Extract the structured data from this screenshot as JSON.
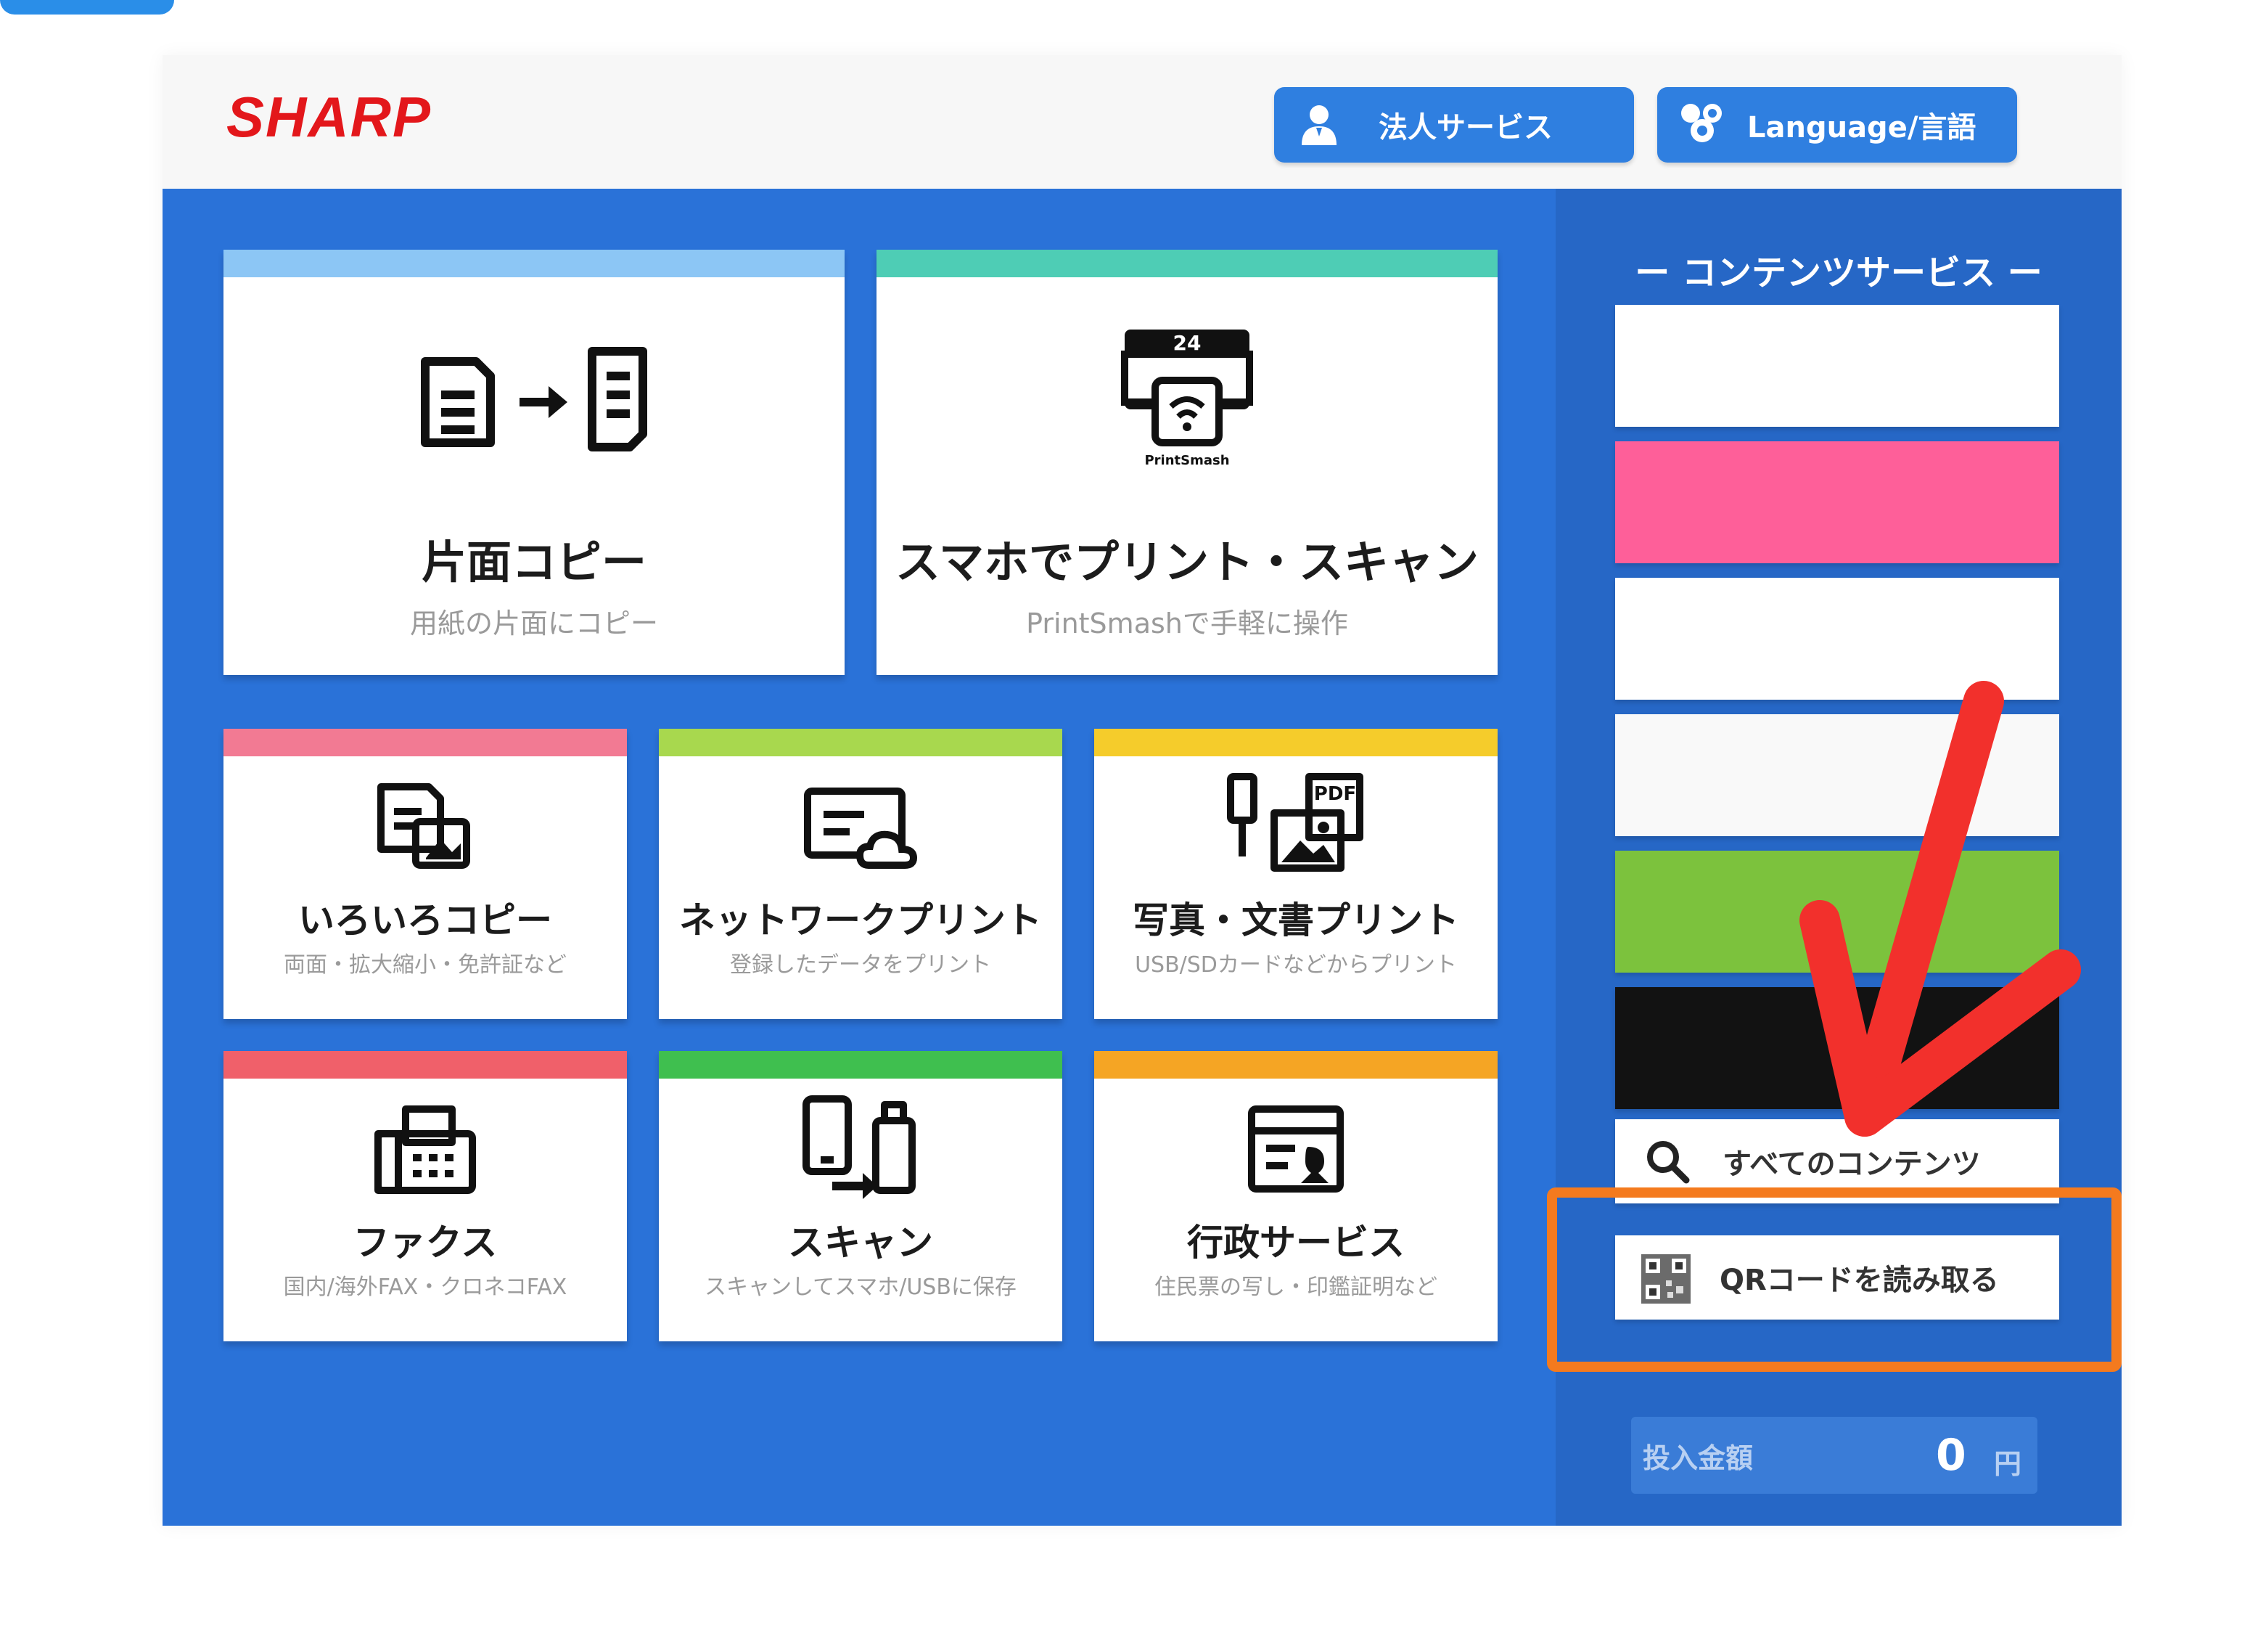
{
  "brand": "SHARP",
  "header": {
    "corporate_label": "法人サービス",
    "language_label": "Language/言語"
  },
  "cards": {
    "copy_single": {
      "title": "片面コピー",
      "sub": "用紙の片面にコピー"
    },
    "smartphone": {
      "title": "スマホでプリント・スキャン",
      "sub": "PrintSmashで手軽に操作",
      "icon_text": "PrintSmash",
      "icon_badge": "24"
    },
    "various_copy": {
      "title": "いろいろコピー",
      "sub": "両面・拡大縮小・免許証など"
    },
    "network_print": {
      "title": "ネットワークプリント",
      "sub": "登録したデータをプリント"
    },
    "photo_print": {
      "title": "写真・文書プリント",
      "sub": "USB/SDカードなどからプリント",
      "icon_text": "PDF"
    },
    "fax": {
      "title": "ファクス",
      "sub": "国内/海外FAX・クロネコFAX"
    },
    "scan": {
      "title": "スキャン",
      "sub": "スキャンしてスマホ/USBに保存"
    },
    "gov": {
      "title": "行政サービス",
      "sub": "住民票の写し・印鑑証明など"
    }
  },
  "sidebar": {
    "title": "ー コンテンツサービス ー",
    "all_contents": "すべてのコンテンツ",
    "qr_reader": "QRコードを読み取る",
    "amount_label": "投入金額",
    "amount_value": "0",
    "amount_unit": "円"
  },
  "colors": {
    "brand_red": "#e3171b",
    "main_blue": "#2a72d8",
    "sidebar_blue": "#2667c6",
    "stripe_light_blue": "#8cc6f5",
    "stripe_teal": "#4ecdb5",
    "stripe_pink": "#f27a93",
    "stripe_lime": "#a8d84e",
    "stripe_yellow": "#f5cc2b",
    "stripe_red": "#f0606a",
    "stripe_green": "#3fbf4f",
    "stripe_orange": "#f5a524",
    "banner_pink": "#fe5f99",
    "banner_green": "#7cc23d",
    "banner_black": "#121212",
    "highlight_orange": "#f47a1e",
    "arrow_red": "#f2302c"
  }
}
